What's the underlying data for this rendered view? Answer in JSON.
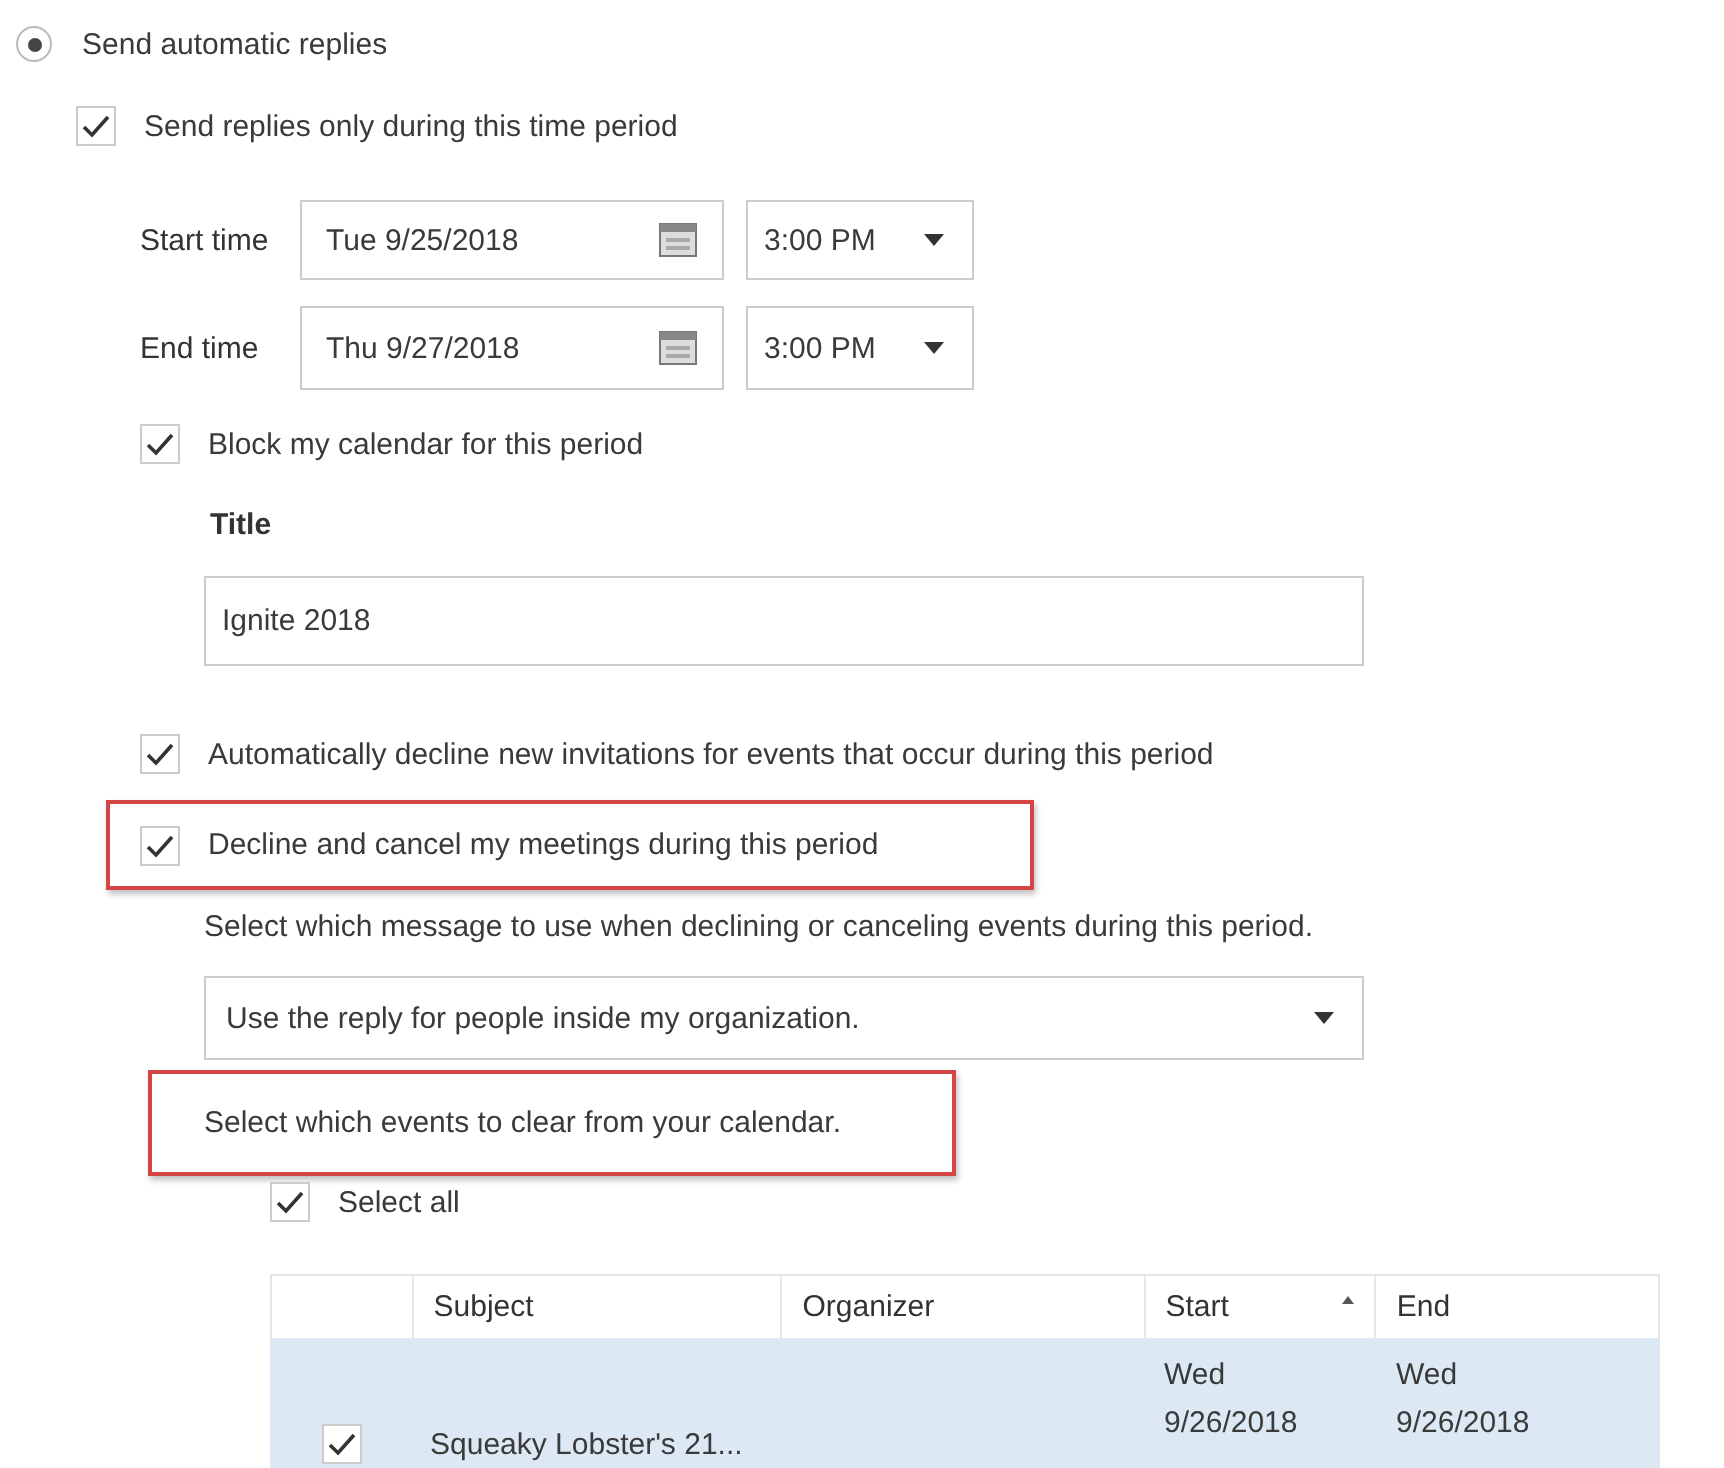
{
  "auto_reply": {
    "label": "Send automatic replies",
    "selected": true
  },
  "time_period": {
    "label": "Send replies only during this time period",
    "checked": true
  },
  "times": [
    {
      "label": "Start time",
      "date": "Tue 9/25/2018",
      "time": "3:00 PM"
    },
    {
      "label": "End time",
      "date": "Thu 9/27/2018",
      "time": "3:00 PM"
    }
  ],
  "block_calendar": {
    "label": "Block my calendar for this period",
    "checked": true
  },
  "title": {
    "label": "Title",
    "value": "Ignite 2018"
  },
  "options": [
    {
      "label": "Automatically decline new invitations for events that occur during this period",
      "checked": true,
      "highlighted": false
    },
    {
      "label": "Decline and cancel my meetings during this period",
      "checked": true,
      "highlighted": true
    }
  ],
  "message_prompt": "Select which message to use when declining or canceling events during this period.",
  "message_select": {
    "value": "Use the reply for people inside my organization."
  },
  "events_prompt": {
    "text": "Select which events to clear from your calendar.",
    "highlighted": true
  },
  "select_all": {
    "label": "Select all",
    "checked": true
  },
  "table": {
    "columns": [
      {
        "label": "Subject",
        "sorted": false
      },
      {
        "label": "Organizer",
        "sorted": false
      },
      {
        "label": "Start",
        "sorted": true
      },
      {
        "label": "End",
        "sorted": false
      }
    ],
    "rows": [
      {
        "checked": true,
        "selected": true,
        "subject": "Squeaky Lobster's 21...",
        "start": [
          "Wed",
          "9/26/2018"
        ],
        "end": [
          "Wed",
          "9/26/2018"
        ]
      }
    ]
  }
}
